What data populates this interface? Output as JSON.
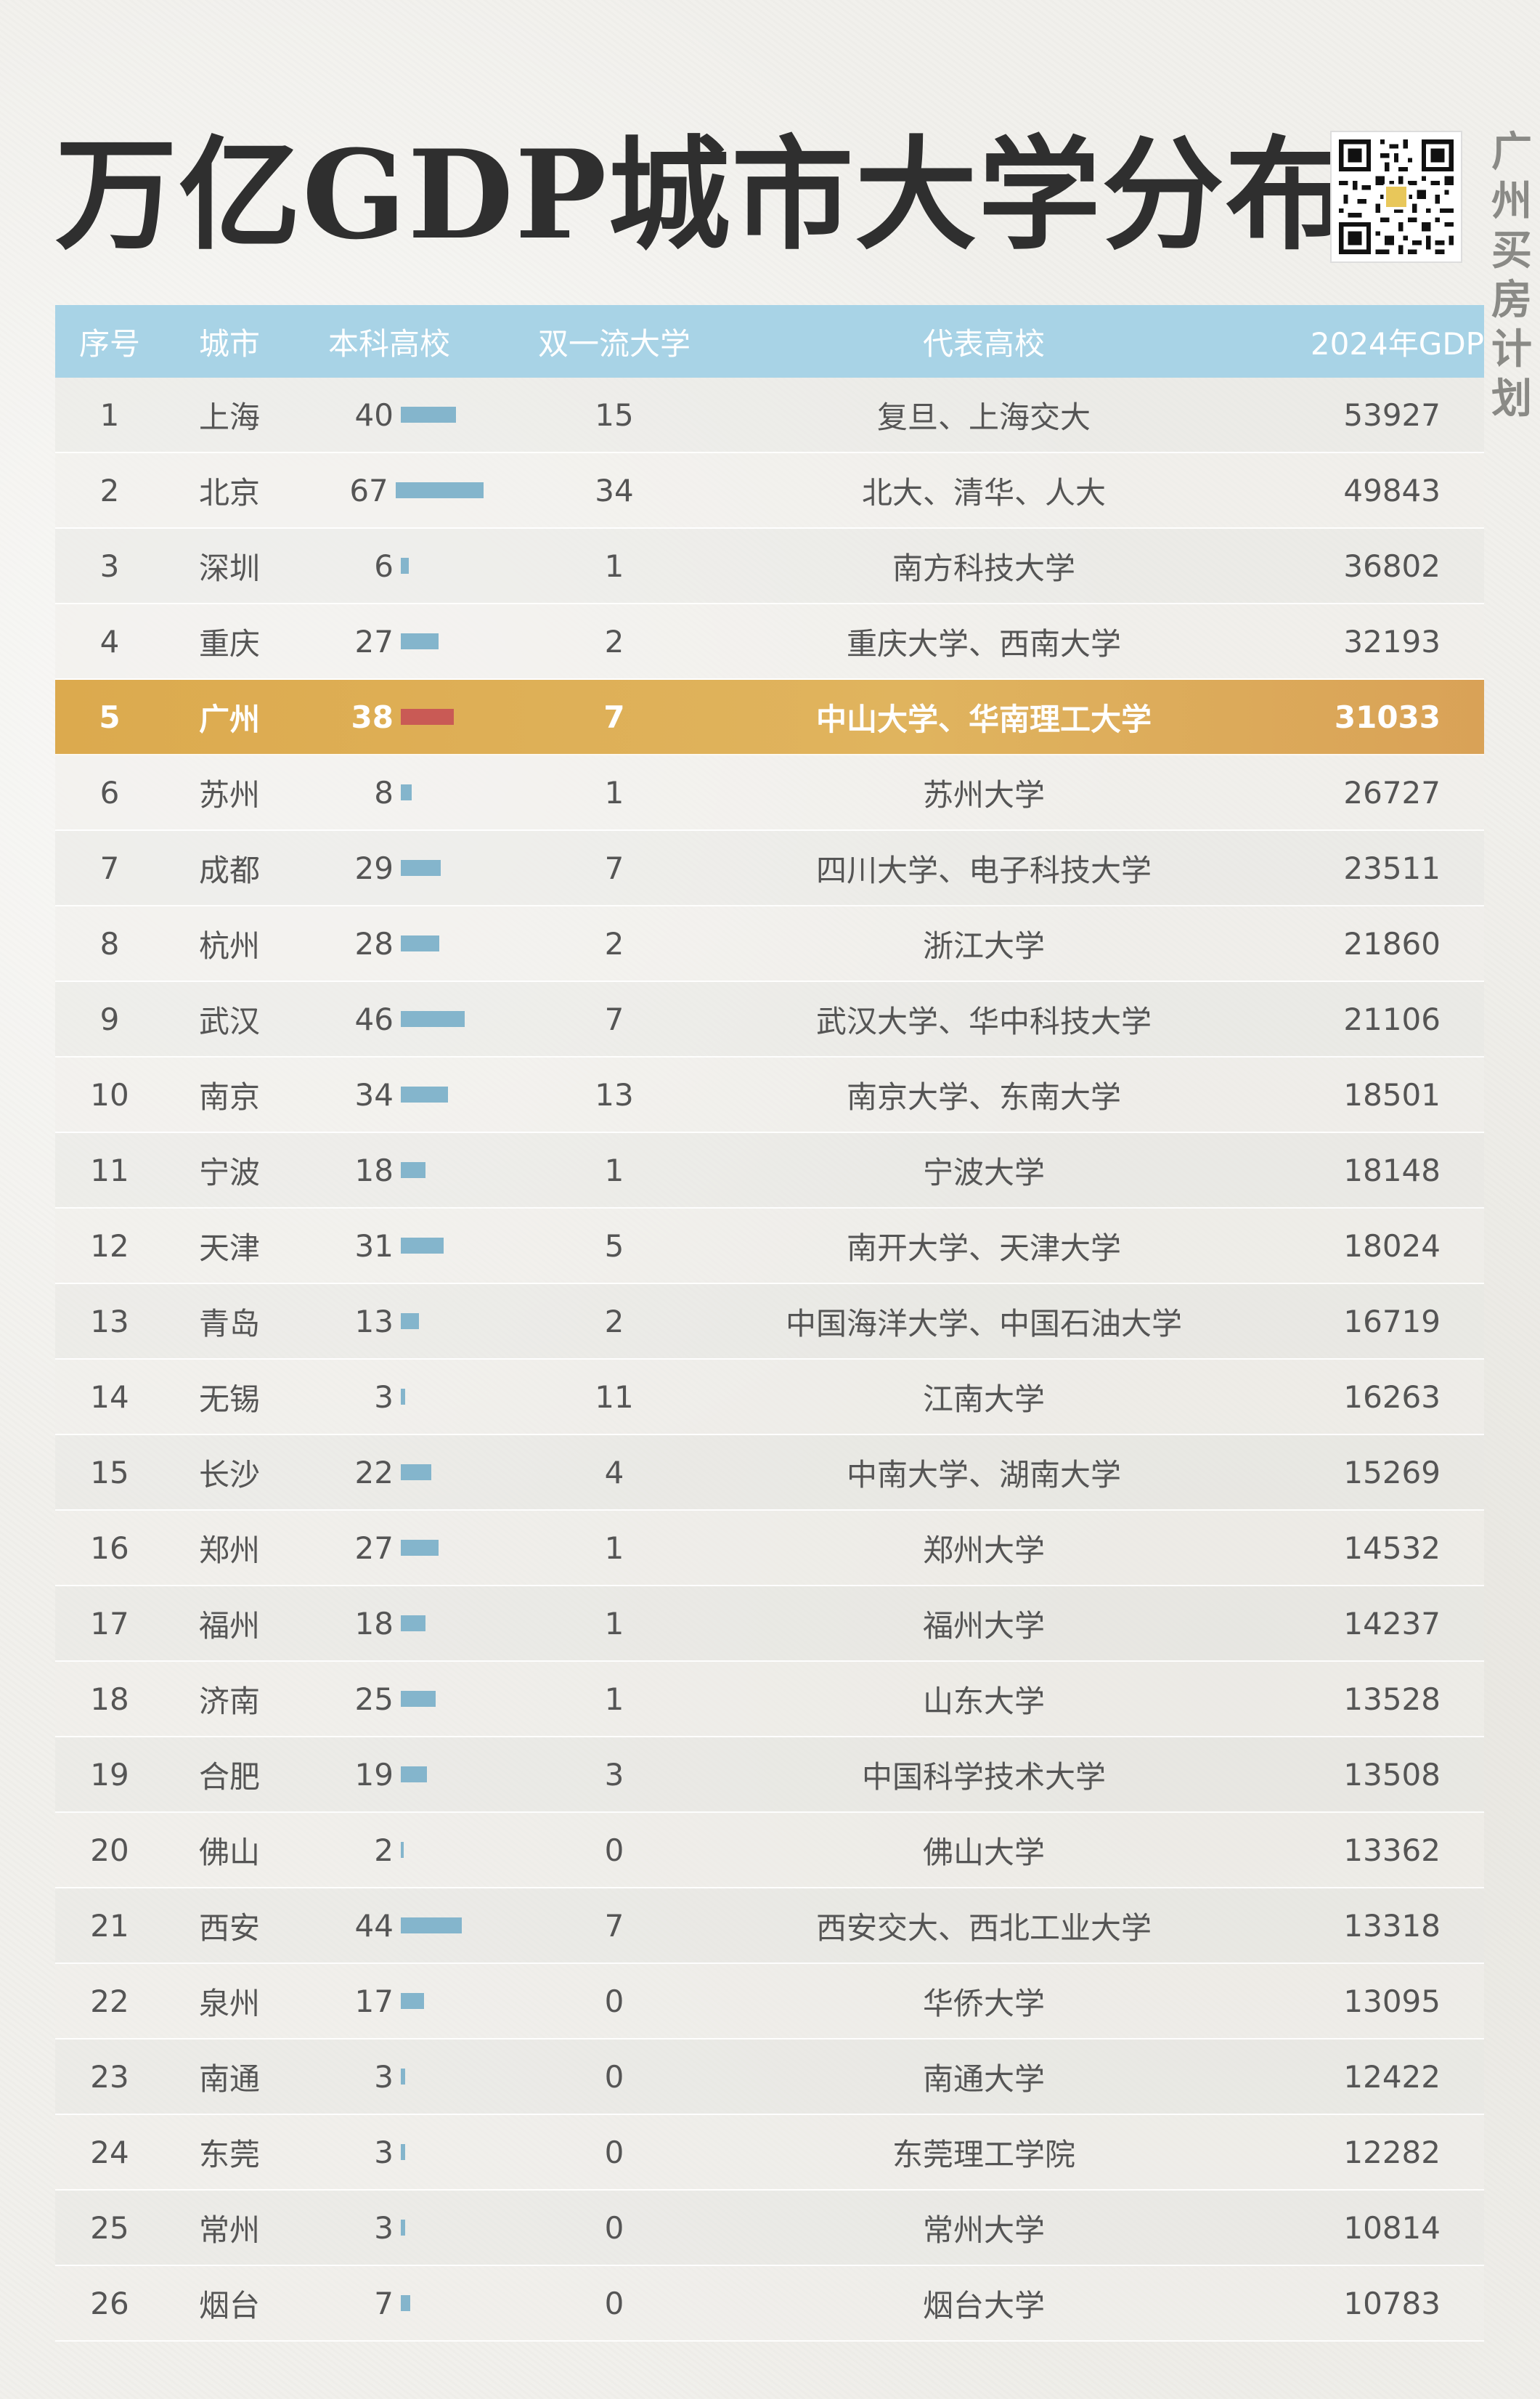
{
  "title": "万亿GDP城市大学分布",
  "brand": [
    "广",
    "州",
    "买",
    "房",
    "计",
    "划"
  ],
  "colors": {
    "header": "#a8d3e6",
    "bar": "#84b5cc",
    "highlight": "#dcaa4e",
    "highlight_bar": "#c95a55"
  },
  "headers": {
    "rank": "序号",
    "city": "城市",
    "undergrad": "本科高校",
    "double": "双一流大学",
    "rep": "代表高校",
    "gdp": "2024年GDP"
  },
  "max_undergrad": 67,
  "rows": [
    {
      "rank": "1",
      "city": "上海",
      "undergrad": 40,
      "double": "15",
      "rep": "复旦、上海交大",
      "gdp": "53927"
    },
    {
      "rank": "2",
      "city": "北京",
      "undergrad": 67,
      "double": "34",
      "rep": "北大、清华、人大",
      "gdp": "49843"
    },
    {
      "rank": "3",
      "city": "深圳",
      "undergrad": 6,
      "double": "1",
      "rep": "南方科技大学",
      "gdp": "36802"
    },
    {
      "rank": "4",
      "city": "重庆",
      "undergrad": 27,
      "double": "2",
      "rep": "重庆大学、西南大学",
      "gdp": "32193"
    },
    {
      "rank": "5",
      "city": "广州",
      "undergrad": 38,
      "double": "7",
      "rep": "中山大学、华南理工大学",
      "gdp": "31033",
      "highlight": true
    },
    {
      "rank": "6",
      "city": "苏州",
      "undergrad": 8,
      "double": "1",
      "rep": "苏州大学",
      "gdp": "26727"
    },
    {
      "rank": "7",
      "city": "成都",
      "undergrad": 29,
      "double": "7",
      "rep": "四川大学、电子科技大学",
      "gdp": "23511"
    },
    {
      "rank": "8",
      "city": "杭州",
      "undergrad": 28,
      "double": "2",
      "rep": "浙江大学",
      "gdp": "21860"
    },
    {
      "rank": "9",
      "city": "武汉",
      "undergrad": 46,
      "double": "7",
      "rep": "武汉大学、华中科技大学",
      "gdp": "21106"
    },
    {
      "rank": "10",
      "city": "南京",
      "undergrad": 34,
      "double": "13",
      "rep": "南京大学、东南大学",
      "gdp": "18501"
    },
    {
      "rank": "11",
      "city": "宁波",
      "undergrad": 18,
      "double": "1",
      "rep": "宁波大学",
      "gdp": "18148"
    },
    {
      "rank": "12",
      "city": "天津",
      "undergrad": 31,
      "double": "5",
      "rep": "南开大学、天津大学",
      "gdp": "18024"
    },
    {
      "rank": "13",
      "city": "青岛",
      "undergrad": 13,
      "double": "2",
      "rep": "中国海洋大学、中国石油大学",
      "gdp": "16719"
    },
    {
      "rank": "14",
      "city": "无锡",
      "undergrad": 3,
      "double": "11",
      "rep": "江南大学",
      "gdp": "16263"
    },
    {
      "rank": "15",
      "city": "长沙",
      "undergrad": 22,
      "double": "4",
      "rep": "中南大学、湖南大学",
      "gdp": "15269"
    },
    {
      "rank": "16",
      "city": "郑州",
      "undergrad": 27,
      "double": "1",
      "rep": "郑州大学",
      "gdp": "14532"
    },
    {
      "rank": "17",
      "city": "福州",
      "undergrad": 18,
      "double": "1",
      "rep": "福州大学",
      "gdp": "14237"
    },
    {
      "rank": "18",
      "city": "济南",
      "undergrad": 25,
      "double": "1",
      "rep": "山东大学",
      "gdp": "13528"
    },
    {
      "rank": "19",
      "city": "合肥",
      "undergrad": 19,
      "double": "3",
      "rep": "中国科学技术大学",
      "gdp": "13508"
    },
    {
      "rank": "20",
      "city": "佛山",
      "undergrad": 2,
      "double": "0",
      "rep": "佛山大学",
      "gdp": "13362"
    },
    {
      "rank": "21",
      "city": "西安",
      "undergrad": 44,
      "double": "7",
      "rep": "西安交大、西北工业大学",
      "gdp": "13318"
    },
    {
      "rank": "22",
      "city": "泉州",
      "undergrad": 17,
      "double": "0",
      "rep": "华侨大学",
      "gdp": "13095"
    },
    {
      "rank": "23",
      "city": "南通",
      "undergrad": 3,
      "double": "0",
      "rep": "南通大学",
      "gdp": "12422"
    },
    {
      "rank": "24",
      "city": "东莞",
      "undergrad": 3,
      "double": "0",
      "rep": "东莞理工学院",
      "gdp": "12282"
    },
    {
      "rank": "25",
      "city": "常州",
      "undergrad": 3,
      "double": "0",
      "rep": "常州大学",
      "gdp": "10814"
    },
    {
      "rank": "26",
      "city": "烟台",
      "undergrad": 7,
      "double": "0",
      "rep": "烟台大学",
      "gdp": "10783"
    }
  ]
}
